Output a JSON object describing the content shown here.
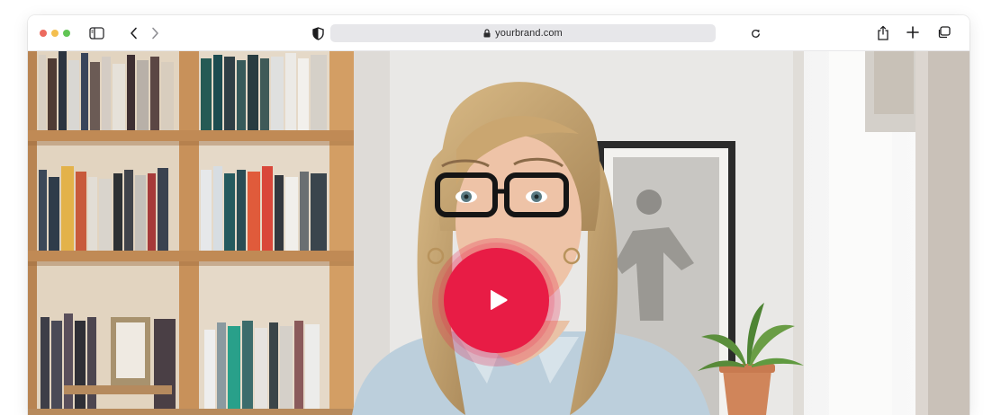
{
  "browser": {
    "url": "yourbrand.com",
    "icons": {
      "sidebar": "sidebar-toggle-icon",
      "back": "chevron-left-icon",
      "forward": "chevron-right-icon",
      "privacy": "shield-icon",
      "lock": "lock-icon",
      "reload": "reload-icon",
      "share": "share-icon",
      "new_tab": "plus-icon",
      "tabs": "tab-overview-icon"
    },
    "colors": {
      "close": "#ec6a5e",
      "minimize": "#f4bf4f",
      "zoom": "#61c554"
    }
  },
  "video": {
    "play_icon": "play-icon",
    "play_button_color": "#e81c45"
  }
}
